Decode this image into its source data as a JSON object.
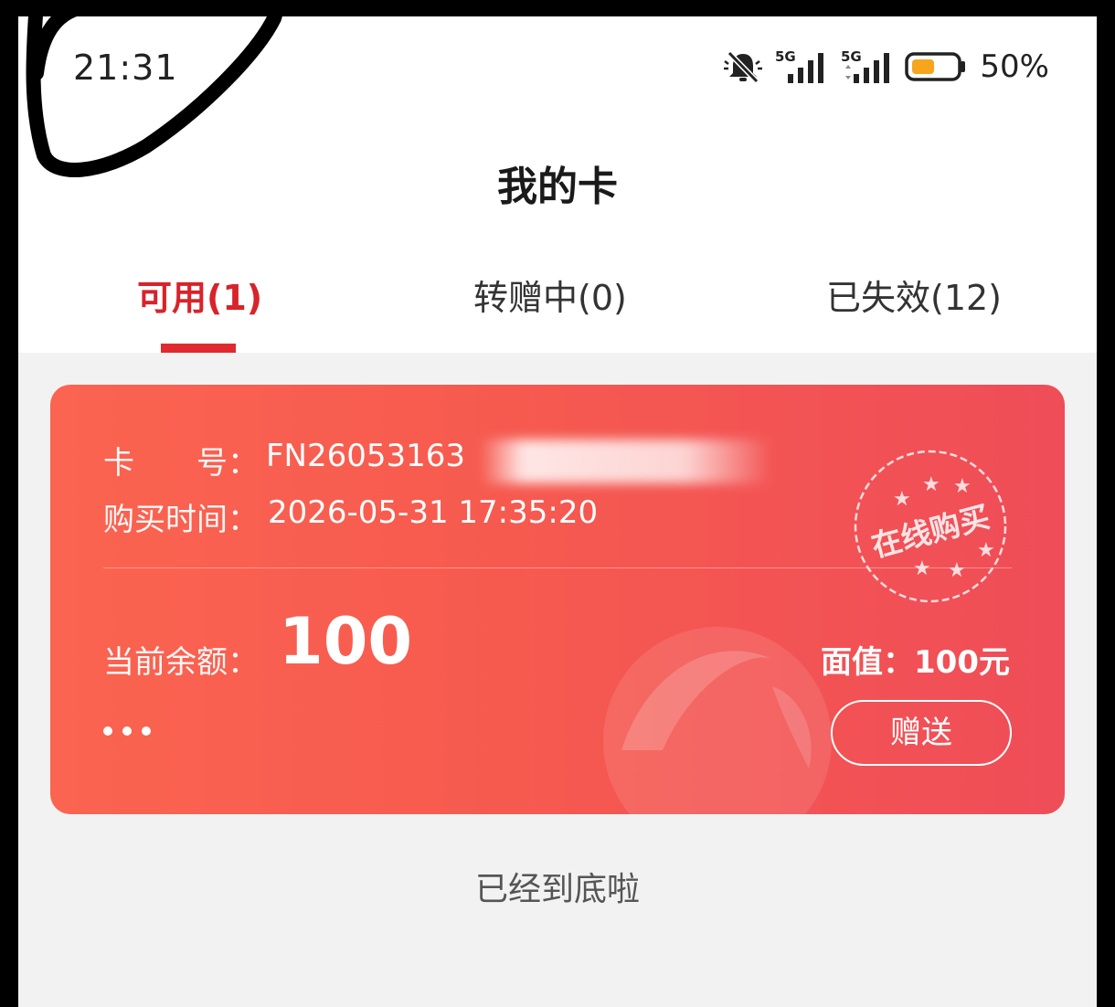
{
  "status_bar": {
    "time": "21:31",
    "network1": "5G",
    "network2": "5G",
    "battery_percent": "50%",
    "icons": [
      "mute-bell-icon",
      "signal-5g-icon",
      "signal-5g-icon",
      "battery-icon"
    ]
  },
  "header": {
    "title": "我的卡"
  },
  "tabs": [
    {
      "label": "可用(1)",
      "active": true
    },
    {
      "label": "转赠中(0)",
      "active": false
    },
    {
      "label": "已失效(12)",
      "active": false
    }
  ],
  "card": {
    "card_number_label": "卡　　号：",
    "card_number_value": "FN26053163",
    "purchase_time_label": "购买时间：",
    "purchase_time_value": "2026-05-31 17:35:20",
    "stamp_text": "在线购买",
    "balance_label": "当前余额：",
    "balance_value": "100",
    "face_value_label": "面值：100元",
    "gift_button_label": "赠送",
    "colors": {
      "gradient_start": "#fb6450",
      "gradient_end": "#ef4d58"
    }
  },
  "footer": {
    "end_text": "已经到底啦"
  },
  "colors": {
    "accent": "#d8232a",
    "background": "#f2f2f2"
  }
}
